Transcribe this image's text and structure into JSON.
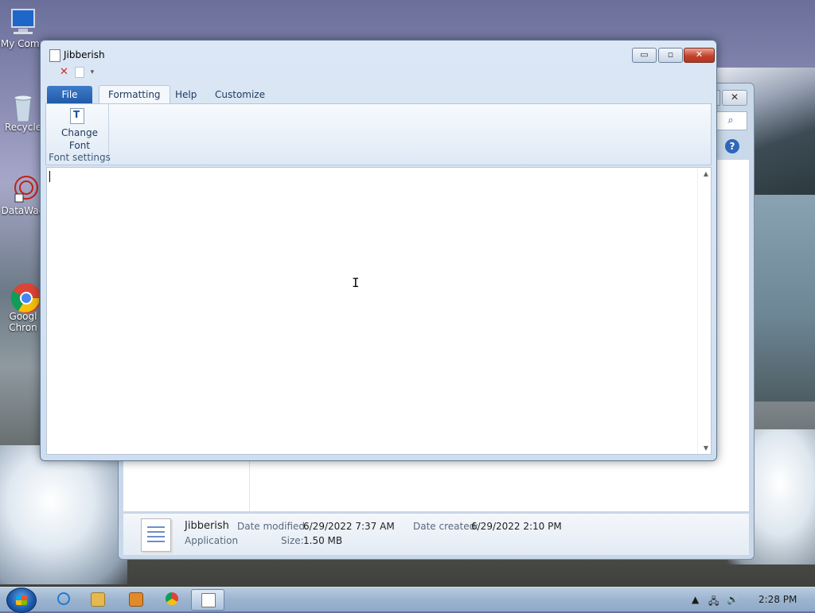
{
  "desktop": {
    "icons": [
      {
        "label": "My Comp",
        "icon": "computer-icon"
      },
      {
        "label": "Recycle",
        "icon": "recycle-bin-icon"
      },
      {
        "label": "DataWag",
        "icon": "datawag-icon"
      },
      {
        "label": "Googl\nChron",
        "icon": "chrome-icon"
      }
    ]
  },
  "background_window": {
    "close_glyph": "✕",
    "search_glyph": "⌕",
    "help_glyph": "?",
    "details": {
      "name": "Jibberish",
      "type": "Application",
      "date_modified_label": "Date modified:",
      "date_modified": "6/29/2022 7:37 AM",
      "date_created_label": "Date created:",
      "date_created": "6/29/2022 2:10 PM",
      "size_label": "Size:",
      "size": "1.50 MB"
    }
  },
  "main_window": {
    "title": "Jibberish",
    "controls": {
      "minimize": "▭",
      "maximize": "▫",
      "close": "✕"
    },
    "quick_access": {
      "delete_glyph": "✕",
      "dropdown_glyph": "▾"
    },
    "tabs": {
      "file": "File",
      "formatting": "Formatting",
      "help": "Help",
      "customize": "Customize"
    },
    "ribbon": {
      "change_font_line1": "Change",
      "change_font_line2": "Font",
      "group_label": "Font settings"
    },
    "editor": {
      "content": "",
      "scroll_up": "▲",
      "scroll_down": "▼",
      "cursor_glyph": "I"
    }
  },
  "taskbar": {
    "clock": "2:28 PM",
    "tray_arrow": "▲",
    "volume_glyph": "🔊",
    "network_glyph": "🖧",
    "colors": {
      "ie": "#1f7ad6",
      "explorer": "#e5b94d",
      "media": "#e08a2a",
      "chrome": "#db4437",
      "jibberish": "#ffffff"
    }
  }
}
